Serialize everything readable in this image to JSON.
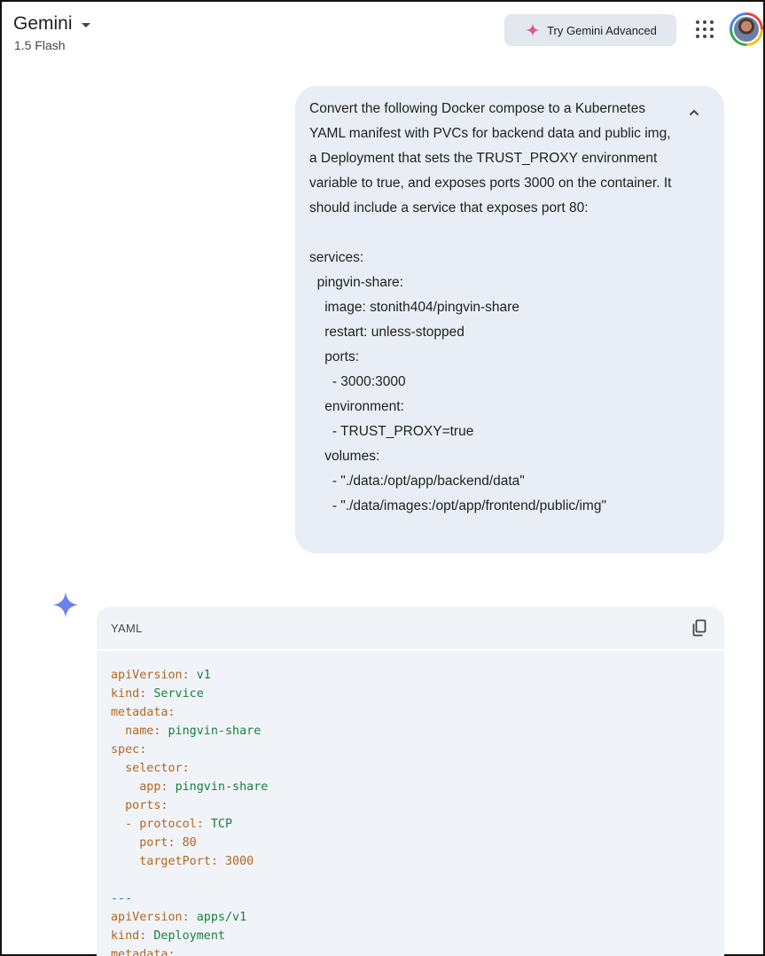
{
  "header": {
    "title": "Gemini",
    "model": "1.5 Flash",
    "try_advanced_label": "Try Gemini Advanced",
    "apps_icon": "apps-grid-icon",
    "avatar_icon": "user-avatar"
  },
  "prompt": {
    "text": "Convert the following Docker compose to a Kubernetes YAML manifest with PVCs for backend data and public img, a Deployment that sets the TRUST_PROXY environment variable to true, and exposes ports 3000 on the container. It should include a service that exposes port 80:\n\nservices:\n  pingvin-share:\n    image: stonith404/pingvin-share\n    restart: unless-stopped\n    ports:\n      - 3000:3000\n    environment:\n      - TRUST_PROXY=true\n    volumes:\n      - \"./data:/opt/app/backend/data\"\n      - \"./data/images:/opt/app/frontend/public/img\"",
    "collapse_icon": "chevron-up-icon"
  },
  "response": {
    "code_language": "YAML",
    "copy_icon": "copy-icon",
    "code_lines": [
      {
        "indent": "",
        "prefix": "",
        "key": "apiVersion",
        "value": "v1",
        "vtype": "val"
      },
      {
        "indent": "",
        "prefix": "",
        "key": "kind",
        "value": "Service",
        "vtype": "val"
      },
      {
        "indent": "",
        "prefix": "",
        "key": "metadata",
        "value": "",
        "vtype": "val"
      },
      {
        "indent": "  ",
        "prefix": "",
        "key": "name",
        "value": "pingvin-share",
        "vtype": "val"
      },
      {
        "indent": "",
        "prefix": "",
        "key": "spec",
        "value": "",
        "vtype": "val"
      },
      {
        "indent": "  ",
        "prefix": "",
        "key": "selector",
        "value": "",
        "vtype": "val"
      },
      {
        "indent": "    ",
        "prefix": "",
        "key": "app",
        "value": "pingvin-share",
        "vtype": "val"
      },
      {
        "indent": "  ",
        "prefix": "",
        "key": "ports",
        "value": "",
        "vtype": "val"
      },
      {
        "indent": "  ",
        "prefix": "- ",
        "key": "protocol",
        "value": "TCP",
        "vtype": "val"
      },
      {
        "indent": "    ",
        "prefix": "",
        "key": "port",
        "value": "80",
        "vtype": "num"
      },
      {
        "indent": "    ",
        "prefix": "",
        "key": "targetPort",
        "value": "3000",
        "vtype": "num"
      },
      {
        "indent": "",
        "prefix": "",
        "key": "",
        "value": "",
        "vtype": "blank"
      },
      {
        "indent": "",
        "prefix": "",
        "key": "",
        "value": "---",
        "vtype": "sep"
      },
      {
        "indent": "",
        "prefix": "",
        "key": "apiVersion",
        "value": "apps/v1",
        "vtype": "val"
      },
      {
        "indent": "",
        "prefix": "",
        "key": "kind",
        "value": "Deployment",
        "vtype": "val"
      },
      {
        "indent": "",
        "prefix": "",
        "key": "metadata",
        "value": "",
        "vtype": "val"
      }
    ]
  },
  "colors": {
    "bubble": "#e9eef6",
    "code_bg": "#f0f4f9",
    "yaml_key": "#b5651d",
    "yaml_value": "#188038",
    "yaml_separator": "#1a73e8"
  }
}
